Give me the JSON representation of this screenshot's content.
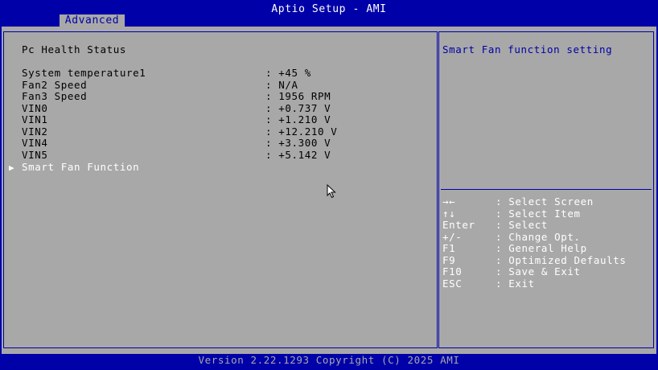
{
  "header": {
    "title": "Aptio Setup - AMI",
    "active_tab": "Advanced"
  },
  "page": {
    "section_title": "Pc Health Status",
    "readings": [
      {
        "label": "System temperature1",
        "value": ": +45 %"
      },
      {
        "label": "Fan2 Speed",
        "value": ": N/A"
      },
      {
        "label": "Fan3 Speed",
        "value": ": 1956 RPM"
      },
      {
        "label": "VIN0",
        "value": ": +0.737 V"
      },
      {
        "label": "VIN1",
        "value": ": +1.210 V"
      },
      {
        "label": "VIN2",
        "value": ": +12.210 V"
      },
      {
        "label": "VIN4",
        "value": ": +3.300 V"
      },
      {
        "label": "VIN5",
        "value": ": +5.142 V"
      }
    ],
    "submenu": {
      "label": "Smart Fan Function",
      "arrow_icon": "triangle-right-icon"
    }
  },
  "help": {
    "text": "Smart Fan function setting",
    "keys": [
      {
        "key": "→←",
        "desc": ": Select Screen"
      },
      {
        "key": "↑↓",
        "desc": ": Select Item"
      },
      {
        "key": "Enter",
        "desc": ": Select"
      },
      {
        "key": "+/-",
        "desc": ": Change Opt."
      },
      {
        "key": "F1",
        "desc": ": General Help"
      },
      {
        "key": "F9",
        "desc": ": Optimized Defaults"
      },
      {
        "key": "F10",
        "desc": ": Save & Exit"
      },
      {
        "key": "ESC",
        "desc": ": Exit"
      }
    ]
  },
  "footer": {
    "text": "Version 2.22.1293 Copyright (C) 2025 AMI"
  },
  "colors": {
    "blue": "#0000a8",
    "gray": "#a8a8a8",
    "white": "#ffffff",
    "black": "#000000"
  }
}
